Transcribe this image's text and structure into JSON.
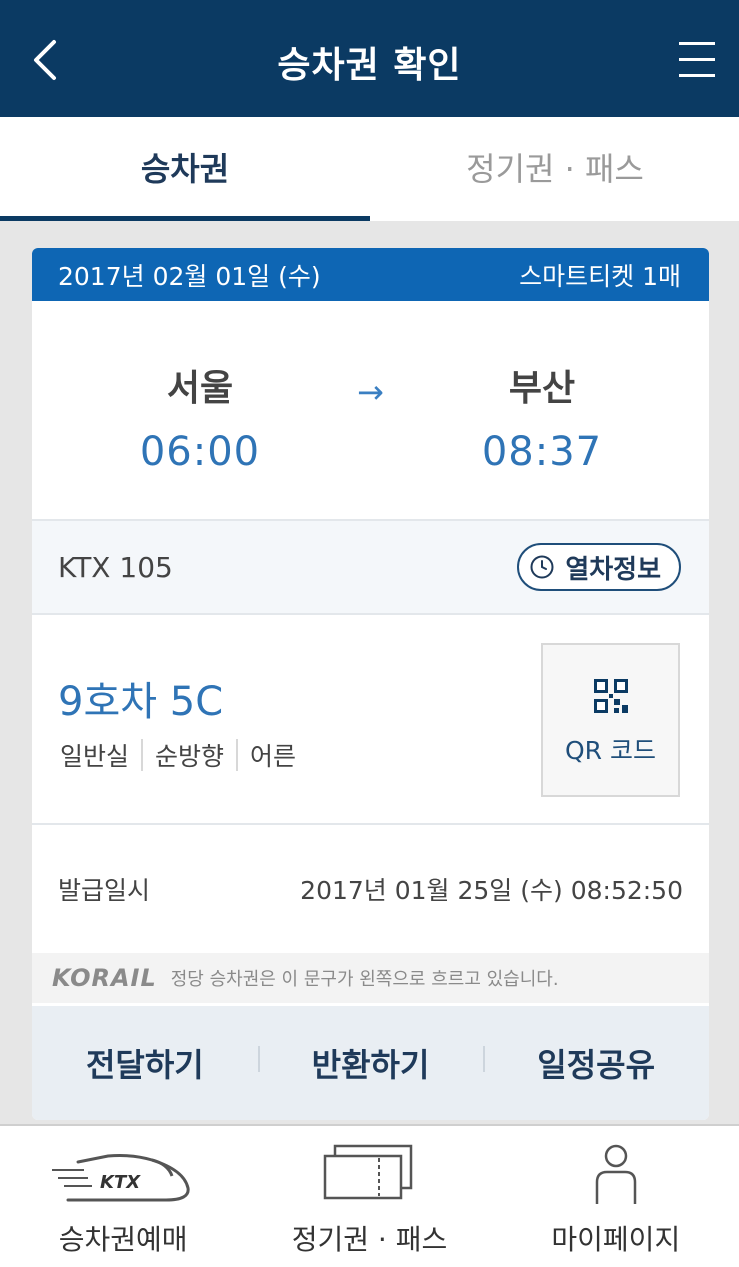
{
  "header": {
    "title": "승차권 확인"
  },
  "tabs": [
    {
      "label": "승차권"
    },
    {
      "label": "정기권 · 패스"
    }
  ],
  "ticket": {
    "date": "2017년 02월 01일 (수)",
    "ticket_type": "스마트티켓 1매",
    "departure": {
      "station": "서울",
      "time": "06:00"
    },
    "arrival": {
      "station": "부산",
      "time": "08:37"
    },
    "train": "KTX 105",
    "train_info_label": "열차정보",
    "seat": "9호차 5C",
    "seat_class": "일반실",
    "direction": "순방향",
    "passenger": "어른",
    "qr_label": "QR 코드",
    "issued_label": "발급일시",
    "issued_value": "2017년 01월 25일 (수) 08:52:50",
    "korail_logo": "KORAIL",
    "validity_text": "정당 승차권은 이 문구가 왼쪽으로 흐르고 있습니다."
  },
  "actions": [
    {
      "label": "전달하기"
    },
    {
      "label": "반환하기"
    },
    {
      "label": "일정공유"
    }
  ],
  "bottom_nav": [
    {
      "label": "승차권예매",
      "icon": "ktx-train-icon",
      "icon_text": "KTX"
    },
    {
      "label": "정기권 · 패스",
      "icon": "ticket-pass-icon"
    },
    {
      "label": "마이페이지",
      "icon": "person-icon"
    }
  ],
  "colors": {
    "header_bg": "#0b3a63",
    "card_head_bg": "#0e66b4",
    "accent_text": "#2f74b6"
  }
}
